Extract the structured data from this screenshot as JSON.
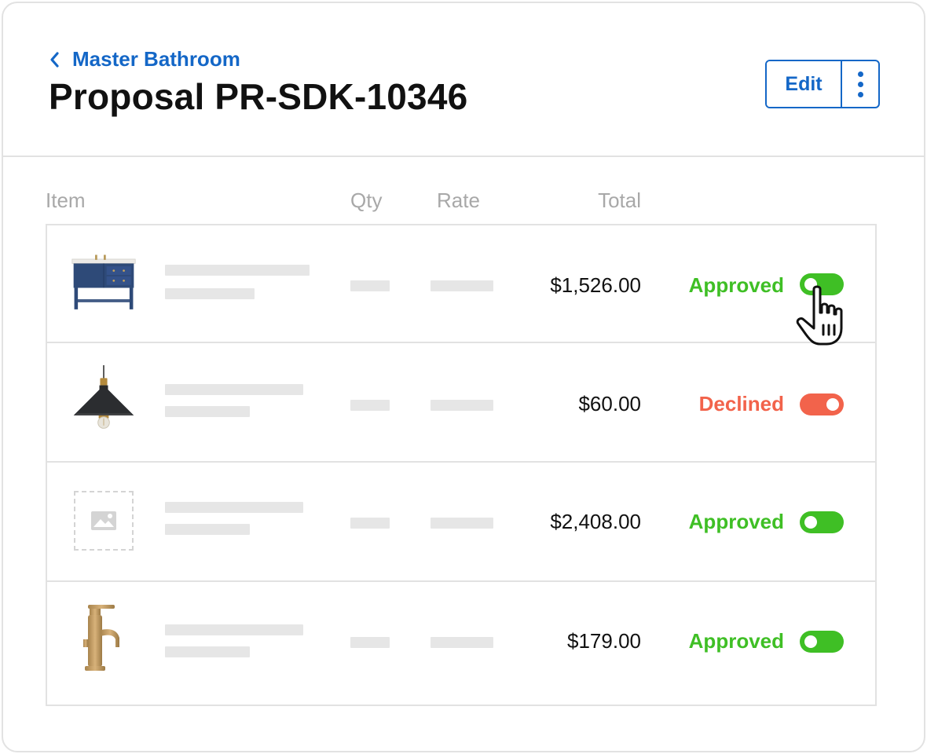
{
  "breadcrumb": {
    "label": "Master Bathroom",
    "icon": "chevron-left-icon"
  },
  "page": {
    "title": "Proposal PR-SDK-10346"
  },
  "actions": {
    "edit_label": "Edit",
    "more_icon": "more-vertical-icon"
  },
  "table": {
    "columns": {
      "item": "Item",
      "qty": "Qty",
      "rate": "Rate",
      "total": "Total"
    },
    "rows": [
      {
        "image": "vanity",
        "total": "$1,526.00",
        "status": "Approved",
        "toggle": "approved"
      },
      {
        "image": "pendant-lamp",
        "total": "$60.00",
        "status": "Declined",
        "toggle": "declined"
      },
      {
        "image": "placeholder",
        "total": "$2,408.00",
        "status": "Approved",
        "toggle": "approved"
      },
      {
        "image": "faucet",
        "total": "$179.00",
        "status": "Approved",
        "toggle": "approved"
      }
    ]
  },
  "colors": {
    "accent": "#1467c7",
    "approved": "#3fbf25",
    "declined": "#f2634b",
    "border": "#e2e2e2",
    "placeholder_bar": "#e6e6e6"
  }
}
